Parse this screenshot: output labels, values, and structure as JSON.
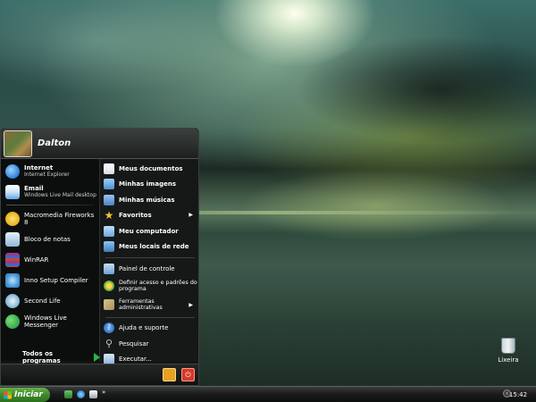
{
  "user": {
    "name": "Dalton"
  },
  "start_menu": {
    "pinned": [
      {
        "title": "Internet",
        "subtitle": "Internet Explorer",
        "icon": "internet-explorer-icon",
        "color": "#2a7fd6"
      },
      {
        "title": "Email",
        "subtitle": "Windows Live Mail desktop",
        "icon": "mail-icon",
        "color": "#5fa8e8"
      }
    ],
    "recent": [
      {
        "label": "Macromedia Fireworks 8",
        "icon": "fireworks-icon",
        "color": "#e5b118"
      },
      {
        "label": "Bloco de notas",
        "icon": "notepad-icon",
        "color": "#8fb7da"
      },
      {
        "label": "WinRAR",
        "icon": "winrar-icon",
        "color": "#9a3a8a"
      },
      {
        "label": "Inno Setup Compiler",
        "icon": "inno-setup-icon",
        "color": "#3b8ed0"
      },
      {
        "label": "Second Life",
        "icon": "second-life-icon",
        "color": "#7fb3d0"
      },
      {
        "label": "Windows Live Messenger",
        "icon": "messenger-icon",
        "color": "#3cb24a"
      }
    ],
    "all_programs": "Todos os programas",
    "places": [
      {
        "label": "Meus documentos",
        "icon": "documents-icon",
        "color": "#d7dde3"
      },
      {
        "label": "Minhas imagens",
        "icon": "pictures-icon",
        "color": "#4d8fd0"
      },
      {
        "label": "Minhas músicas",
        "icon": "music-icon",
        "color": "#4a82c8"
      },
      {
        "label": "Favoritos",
        "icon": "favorites-star-icon",
        "color": "#f2c230"
      },
      {
        "label": "Meu computador",
        "icon": "computer-icon",
        "color": "#6ea6d8"
      },
      {
        "label": "Meus locais de rede",
        "icon": "network-icon",
        "color": "#3e7bc0"
      }
    ],
    "settings": [
      {
        "label": "Painel de controle",
        "icon": "control-panel-icon",
        "color": "#6d9fd6"
      },
      {
        "label": "Definir acesso e padrões do programa",
        "icon": "program-access-icon",
        "color": "#3ca844"
      },
      {
        "label": "Ferramentas administrativas",
        "icon": "admin-tools-icon",
        "color": "#a89060"
      }
    ],
    "help": [
      {
        "label": "Ajuda e suporte",
        "icon": "help-icon",
        "color": "#3073c8"
      },
      {
        "label": "Pesquisar",
        "icon": "search-icon",
        "color": "#c0c8d0"
      },
      {
        "label": "Executar...",
        "icon": "run-icon",
        "color": "#8ab0d8"
      }
    ]
  },
  "taskbar": {
    "start_label": "Iniciar",
    "clock": "15:42"
  },
  "desktop": {
    "recycle_bin_label": "Lixeira"
  }
}
